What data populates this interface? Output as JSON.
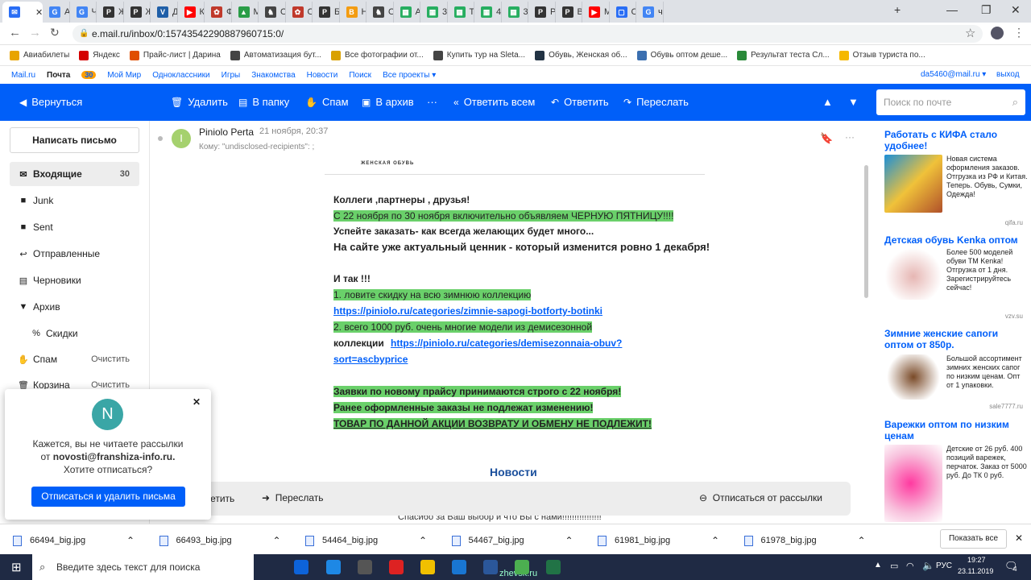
{
  "browser": {
    "tabs": [
      {
        "label": "",
        "icon": "mail-envelope-icon",
        "color": "#2a6ef5"
      },
      {
        "label": "AV",
        "icon": "google-icon",
        "color": "#4285f4"
      },
      {
        "label": "ЧЕ",
        "icon": "google-icon",
        "color": "#4285f4"
      },
      {
        "label": "Же",
        "icon": "p-icon",
        "color": "#333333"
      },
      {
        "label": "Же",
        "icon": "p-icon",
        "color": "#333333"
      },
      {
        "label": "Де",
        "icon": "v-icon",
        "color": "#1f5fa8"
      },
      {
        "label": "Ка",
        "icon": "youtube-icon",
        "color": "#ff0000"
      },
      {
        "label": "Фо",
        "icon": "paw-icon",
        "color": "#c0392b"
      },
      {
        "label": "Мс",
        "icon": "drive-icon",
        "color": "#2a9d48"
      },
      {
        "label": "Од",
        "icon": "shoe-icon",
        "color": "#444444"
      },
      {
        "label": "Од",
        "icon": "paw-icon",
        "color": "#c0392b"
      },
      {
        "label": "Бо",
        "icon": "p-icon",
        "color": "#333333"
      },
      {
        "label": "На",
        "icon": "b-icon",
        "color": "#f39c12"
      },
      {
        "label": "Од",
        "icon": "shoe-icon",
        "color": "#444444"
      },
      {
        "label": "Ав",
        "icon": "grid-icon",
        "color": "#27ae60"
      },
      {
        "label": "3-к",
        "icon": "grid-icon",
        "color": "#27ae60"
      },
      {
        "label": "Та",
        "icon": "grid-icon",
        "color": "#27ae60"
      },
      {
        "label": "4-к",
        "icon": "grid-icon",
        "color": "#27ae60"
      },
      {
        "label": "3-к",
        "icon": "grid-icon",
        "color": "#27ae60"
      },
      {
        "label": "Pir",
        "icon": "p-icon",
        "color": "#333333"
      },
      {
        "label": "Вы",
        "icon": "p-icon",
        "color": "#333333"
      },
      {
        "label": "Ма",
        "icon": "youtube-icon",
        "color": "#ff0000"
      },
      {
        "label": "Со",
        "icon": "chat-icon",
        "color": "#2a6ef5"
      },
      {
        "label": "чер",
        "icon": "google-icon",
        "color": "#4285f4"
      }
    ],
    "url": "e.mail.ru/inbox/0:15743542290887960715:0/",
    "bookmarks": [
      "Авиабилеты",
      "Яндекс",
      "Прайс-лист | Дарина",
      "Автоматизация бут...",
      "Все фотографии от...",
      "Купить тур на Sleta...",
      "Обувь, Женская об...",
      "Обувь оптом деше...",
      "Результат теста Сл...",
      "Отзыв туриста по..."
    ]
  },
  "portal": {
    "links": [
      "Mail.ru",
      "Почта",
      "Мой Мир",
      "Одноклассники",
      "Игры",
      "Знакомства",
      "Новости",
      "Поиск",
      "Все проекты ▾"
    ],
    "mail_badge": "30",
    "user": "da5460@mail.ru ▾",
    "logout": "выход"
  },
  "toolbar": {
    "back": "Вернуться",
    "delete": "Удалить",
    "to_folder": "В папку",
    "spam": "Спам",
    "archive": "В архив",
    "more": "···",
    "reply_all": "Ответить всем",
    "reply": "Ответить",
    "forward": "Переслать",
    "search_placeholder": "Поиск по почте"
  },
  "sidebar": {
    "compose": "Написать письмо",
    "folders": [
      {
        "label": "Входящие",
        "count": "30",
        "icon": "inbox-icon"
      },
      {
        "label": "Junk",
        "count": "",
        "icon": "folder-icon"
      },
      {
        "label": "Sent",
        "count": "",
        "icon": "folder-icon"
      },
      {
        "label": "Отправленные",
        "count": "",
        "icon": "sent-icon"
      },
      {
        "label": "Черновики",
        "count": "",
        "icon": "draft-icon"
      },
      {
        "label": "Архив",
        "count": "",
        "icon": "chevron-down-icon"
      },
      {
        "label": "Скидки",
        "count": "",
        "icon": "percent-icon"
      },
      {
        "label": "Спам",
        "count": "Очистить",
        "icon": "spam-icon"
      },
      {
        "label": "Корзина",
        "count": "Очистить",
        "icon": "trash-icon"
      }
    ]
  },
  "message": {
    "sender": "Piniolo Perta",
    "date": "21 ноября, 20:37",
    "to": "Кому: \"undisclosed-recipients\": ;",
    "avatar_letter": "I",
    "brand": "ЖЕНСКАЯ ОБУВЬ",
    "lines": [
      "Коллеги ,партнеры , друзья!",
      "С 22 ноября по 30 ноября включительно объявляем ЧЕРНУЮ ПЯТНИЦУ!!!!",
      "Успейте заказать- как всегда желающих будет много...",
      "На сайте уже актуальный ценник - который изменится ровно 1 декабря!",
      "И так !!!",
      "1. ловите скидку на всю зимнюю коллекцию",
      "https://piniolo.ru/categories/zimnie-sapogi-botforty-botinki",
      "2. всего 1000 руб. очень многие модели из демисезонной",
      "коллекции",
      "https://piniolo.ru/categories/demisezonnaia-obuv?",
      "sort=ascbyprice",
      "Заявки по новому прайсу принимаются строго с 22 ноября!",
      "Ранее оформленные заказы не подлежат изменению!",
      "ТОВАР ПО ДАННОЙ АКЦИИ ВОЗВРАТУ И ОБМЕНУ НЕ ПОДЛЕЖИТ!"
    ],
    "news_title": "Новости",
    "footer_text": "Спасибо за Ваш выбор и что Вы с нами!!!!!!!!!!!!!!!!"
  },
  "replybar": {
    "reply": "Ответить",
    "forward": "Переслать",
    "unsubscribe": "Отписаться от рассылки"
  },
  "popup": {
    "avatar": "N",
    "line1": "Кажется, вы не читаете рассылки",
    "line2a": "от ",
    "email": "novosti@franshiza-info.ru.",
    "line3": "Хотите отписаться?",
    "button": "Отписаться и удалить письма"
  },
  "ads": [
    {
      "title": "Работать с КИФА стало удобнее!",
      "text": "Новая система оформления заказов. Отгрузка из РФ и Китая. Теперь. Обувь, Сумки, Одежда!",
      "source": "qifa.ru"
    },
    {
      "title": "Детская обувь Kenka оптом",
      "text": "Более 500 моделей обуви ТМ Kenka! Отгрузка от 1 дня. Зарегистрируйтесь сейчас!",
      "source": "vzv.su"
    },
    {
      "title": "Зимние женские сапоги оптом от 850р.",
      "text": "Большой ассортимент зимних женских сапог по низким ценам. Опт от 1 упаковки.",
      "source": "sale7777.ru"
    },
    {
      "title": "Варежки оптом по низким ценам",
      "text": "Детские от 26 руб. 400 позиций варежек, перчаток. Заказ от 5000 руб. До ТК 0 руб.",
      "source": ""
    }
  ],
  "downloads": {
    "files": [
      "66494_big.jpg",
      "66493_big.jpg",
      "54464_big.jpg",
      "54467_big.jpg",
      "61981_big.jpg",
      "61978_big.jpg"
    ],
    "show_all": "Показать все"
  },
  "taskbar": {
    "search_placeholder": "Введите здесь текст для поиска",
    "lang": "РУС",
    "time": "19:27",
    "date": "23.11.2019",
    "notif": "4",
    "watermark": "zhevsk.ru"
  }
}
